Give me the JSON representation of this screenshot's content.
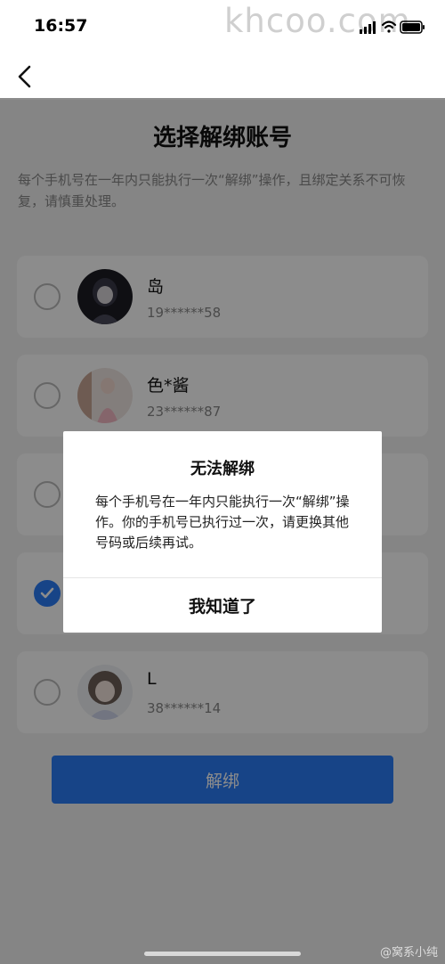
{
  "status_bar": {
    "time": "16:57",
    "watermark": "khcoo.com",
    "icons": [
      "signal-icon",
      "wifi-icon",
      "battery-icon"
    ]
  },
  "nav": {
    "back_icon": "chevron-left-icon"
  },
  "page": {
    "title": "选择解绑账号",
    "description": "每个手机号在一年内只能执行一次“解绑”操作，且绑定关系不可恢复，请慎重处理。"
  },
  "accounts": [
    {
      "name": "岛",
      "phone": "19******58",
      "checked": false
    },
    {
      "name": "色*酱",
      "phone": "23******87",
      "checked": false
    },
    {
      "name": "",
      "phone": "",
      "checked": false
    },
    {
      "name": "",
      "phone": "",
      "checked": true
    },
    {
      "name": "L",
      "phone": "38******14",
      "checked": false
    }
  ],
  "unbind_button": {
    "label": "解绑"
  },
  "dialog": {
    "title": "无法解绑",
    "message": "每个手机号在一年内只能执行一次“解绑”操作。你的手机号已执行过一次，请更换其他号码或后续再试。",
    "confirm_label": "我知道了"
  },
  "footer": {
    "watermark": "@窝系小纯"
  },
  "colors": {
    "accent": "#2b7cf6",
    "overlay": "rgba(0,0,0,0.45)"
  }
}
